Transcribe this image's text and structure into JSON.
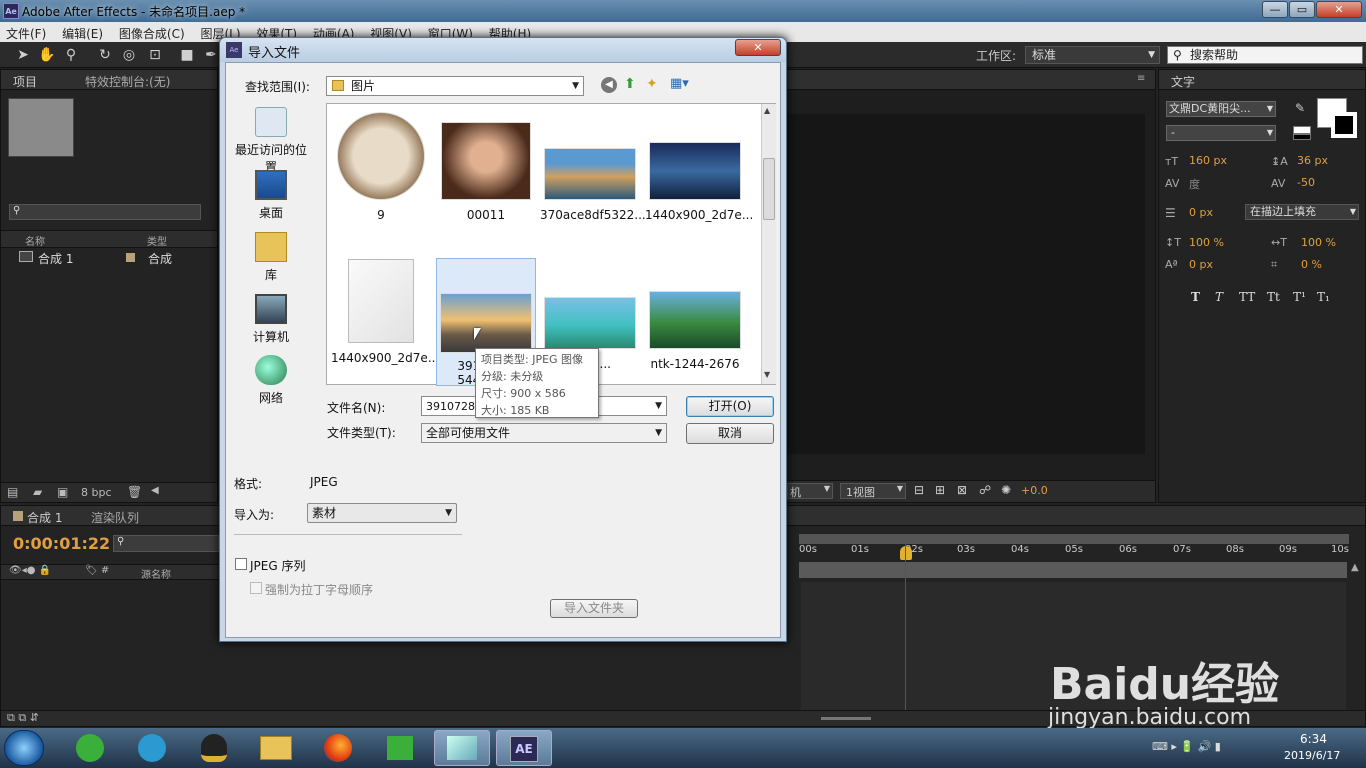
{
  "window": {
    "title": "Adobe After Effects - 未命名项目.aep *",
    "logo": "Ae"
  },
  "menu": [
    "文件(F)",
    "编辑(E)",
    "图像合成(C)",
    "图层(L)",
    "效果(T)",
    "动画(A)",
    "视图(V)",
    "窗口(W)",
    "帮助(H)"
  ],
  "toolbar": {
    "workspace_label": "工作区:",
    "workspace_value": "标准",
    "help_placeholder": "搜索帮助"
  },
  "project_panel": {
    "tab": "项目",
    "effects_tab": "特效控制台:(无)",
    "col_name": "名称",
    "col_type": "类型",
    "item_name": "合成 1",
    "item_type": "合成",
    "bpc": "8 bpc"
  },
  "timeline": {
    "tab": "合成 1",
    "render_tab": "渲染队列",
    "timecode": "0:00:01:22",
    "source_col": "源名称",
    "ruler": [
      "00s",
      "01s",
      "02s",
      "03s",
      "04s",
      "05s",
      "06s",
      "07s",
      "08s",
      "09s",
      "10s"
    ]
  },
  "viewer": {
    "camera": "机",
    "views": "1视图",
    "exposure": "+0.0"
  },
  "text_panel": {
    "tab": "文字",
    "font": "文鼎DC黄阳尖...",
    "style": "-",
    "size": "160 px",
    "leading": "36 px",
    "kerning": "度",
    "tracking": "-50",
    "stroke": "0 px",
    "stroke_mode": "在描边上填充",
    "vscale": "100 %",
    "hscale": "100 %",
    "baseline": "0 px",
    "tsume": "0 %",
    "styles": [
      "T",
      "T",
      "TT",
      "Tt",
      "T¹",
      "T₁"
    ]
  },
  "dialog": {
    "title": "导入文件",
    "close": "✕",
    "lookin_label": "查找范围(I):",
    "lookin_value": "图片",
    "places": [
      "最近访问的位置",
      "桌面",
      "库",
      "计算机",
      "网络"
    ],
    "files": [
      {
        "name": "9"
      },
      {
        "name": "00011"
      },
      {
        "name": "370ace8df5322..."
      },
      {
        "name": "1440x900_2d7e..."
      },
      {
        "name": "1440x900_2d7e..."
      },
      {
        "name": "391072...",
        "name2": "544159..."
      },
      {
        "name": "1400..."
      },
      {
        "name": "ntk-1244-2676"
      }
    ],
    "filename_label": "文件名(N):",
    "filename_value": "39107284_",
    "filetype_label": "文件类型(T):",
    "filetype_value": "全部可使用文件",
    "open_button": "打开(O)",
    "cancel_button": "取消",
    "format_label": "格式:",
    "format_value": "JPEG",
    "import_as_label": "导入为:",
    "import_as_value": "素材",
    "sequence_label": "JPEG 序列",
    "force_alpha_label": "强制为拉丁字母顺序",
    "import_folder_button": "导入文件夹"
  },
  "tooltip": {
    "type": "项目类型: JPEG 图像",
    "rating": "分级: 未分级",
    "dims": "尺寸: 900 x 586",
    "size": "大小: 185 KB"
  },
  "taskbar": {
    "time": "6:34",
    "date": "2019/6/17",
    "ae_label": "AE"
  },
  "watermark": {
    "brand": "Baidu经验",
    "url": "jingyan.baidu.com"
  }
}
